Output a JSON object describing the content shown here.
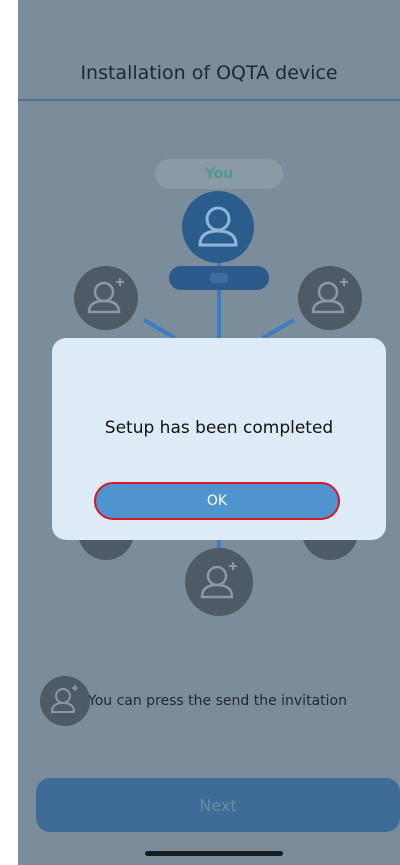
{
  "header": {
    "title": "Installation of OQTA device"
  },
  "diagram": {
    "you_label": "You"
  },
  "hint": {
    "text": "You can press the send the invitation"
  },
  "footer": {
    "next_label": "Next"
  },
  "dialog": {
    "message": "Setup has been completed",
    "ok_label": "OK"
  },
  "colors": {
    "accent": "#4f94cf",
    "highlight_border": "#d11b2a",
    "dialog_bg": "#dcebf5"
  }
}
